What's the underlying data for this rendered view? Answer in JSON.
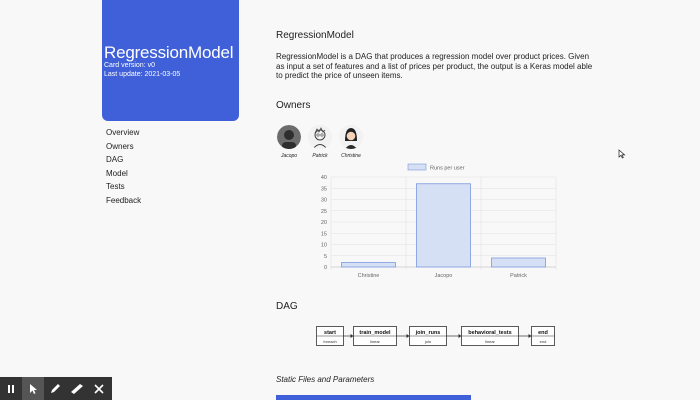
{
  "hero": {
    "title": "RegressionModel",
    "version": "Card version: v0",
    "updated": "Last update: 2021-03-05"
  },
  "nav": [
    "Overview",
    "Owners",
    "DAG",
    "Model",
    "Tests",
    "Feedback"
  ],
  "main": {
    "title": "RegressionModel",
    "description": "RegressionModel is a DAG that produces a regression model over product prices. Given as input a set of features and a list of prices per product, the output is a Keras model able to predict the price of unseen items.",
    "owners_heading": "Owners",
    "owners": [
      "Jacopo",
      "Patrick",
      "Christine"
    ],
    "dag_heading": "DAG",
    "static_heading": "Static Files and Parameters"
  },
  "chart_data": {
    "type": "bar",
    "categories": [
      "Christine",
      "Jacopo",
      "Patrick"
    ],
    "series": [
      {
        "name": "Runs per user",
        "values": [
          2,
          37,
          4
        ]
      }
    ],
    "ylim": [
      0,
      40
    ],
    "yticks": [
      0,
      5,
      10,
      15,
      20,
      25,
      30,
      35,
      40
    ],
    "legend": "top",
    "grid": true,
    "bar_color": "#d6e0f5",
    "bar_border": "#7b98e0"
  },
  "dag": {
    "nodes": [
      {
        "name": "start",
        "type": "foreach"
      },
      {
        "name": "train_model",
        "type": "linear"
      },
      {
        "name": "join_runs",
        "type": "join"
      },
      {
        "name": "behavioral_tests",
        "type": "linear"
      },
      {
        "name": "end",
        "type": "end"
      }
    ]
  },
  "toolbar": {
    "tools": [
      {
        "icon": "pause-icon"
      },
      {
        "icon": "pointer-icon"
      },
      {
        "icon": "pen-icon"
      },
      {
        "icon": "marker-icon"
      },
      {
        "icon": "close-icon"
      }
    ]
  },
  "colors": {
    "accent": "#3f60d9",
    "background": "#f8f8f8"
  }
}
